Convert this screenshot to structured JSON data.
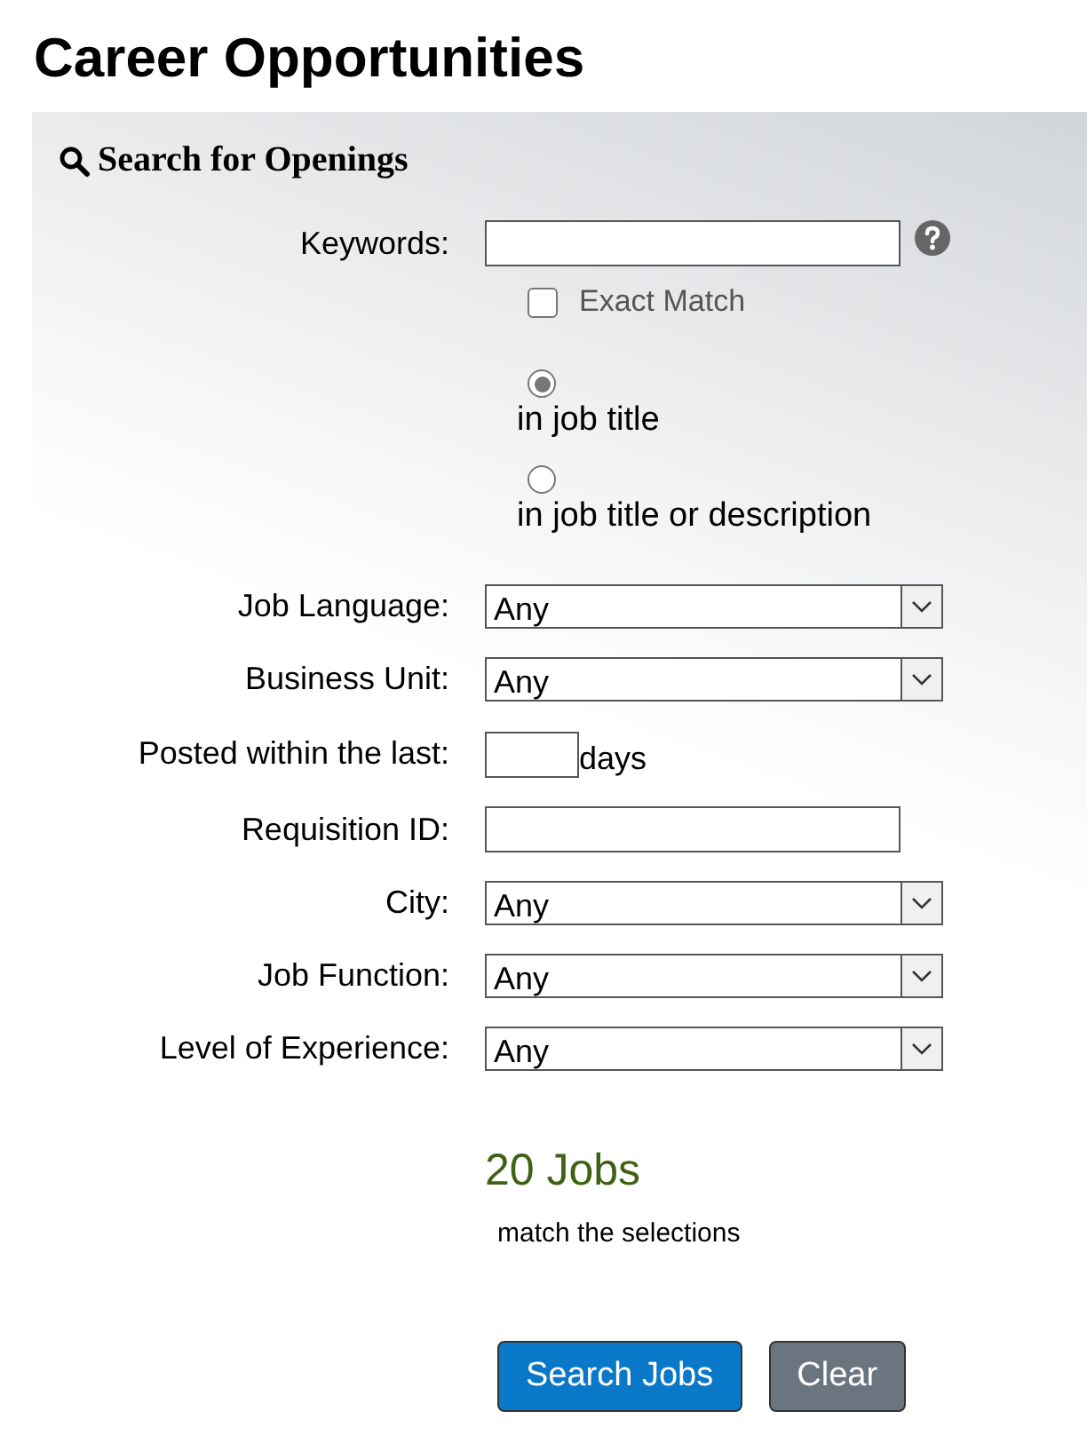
{
  "page_title": "Career Opportunities",
  "search_panel": {
    "title": "Search for Openings",
    "keywords": {
      "label": "Keywords:",
      "help": true,
      "exact_match": {
        "label": "Exact Match",
        "checked": false
      },
      "scope": [
        {
          "label": "in job title",
          "selected": true
        },
        {
          "label": "in job title or description",
          "selected": false
        }
      ]
    },
    "fields": [
      {
        "kind": "select",
        "label": "Job Language:",
        "value": "Any"
      },
      {
        "kind": "select",
        "label": "Business Unit:",
        "value": "Any"
      },
      {
        "kind": "number",
        "label": "Posted within the last:",
        "suffix": "days"
      },
      {
        "kind": "text",
        "label": "Requisition ID:"
      },
      {
        "kind": "select",
        "label": "City:",
        "value": "Any"
      },
      {
        "kind": "select",
        "label": "Job Function:",
        "value": "Any"
      },
      {
        "kind": "select",
        "label": "Level of Experience:",
        "value": "Any"
      }
    ],
    "result": {
      "count": "20 Jobs",
      "note": "match the selections"
    },
    "buttons": [
      {
        "kind": "primary",
        "label": "Search Jobs"
      },
      {
        "kind": "secondary",
        "label": "Clear"
      }
    ]
  }
}
